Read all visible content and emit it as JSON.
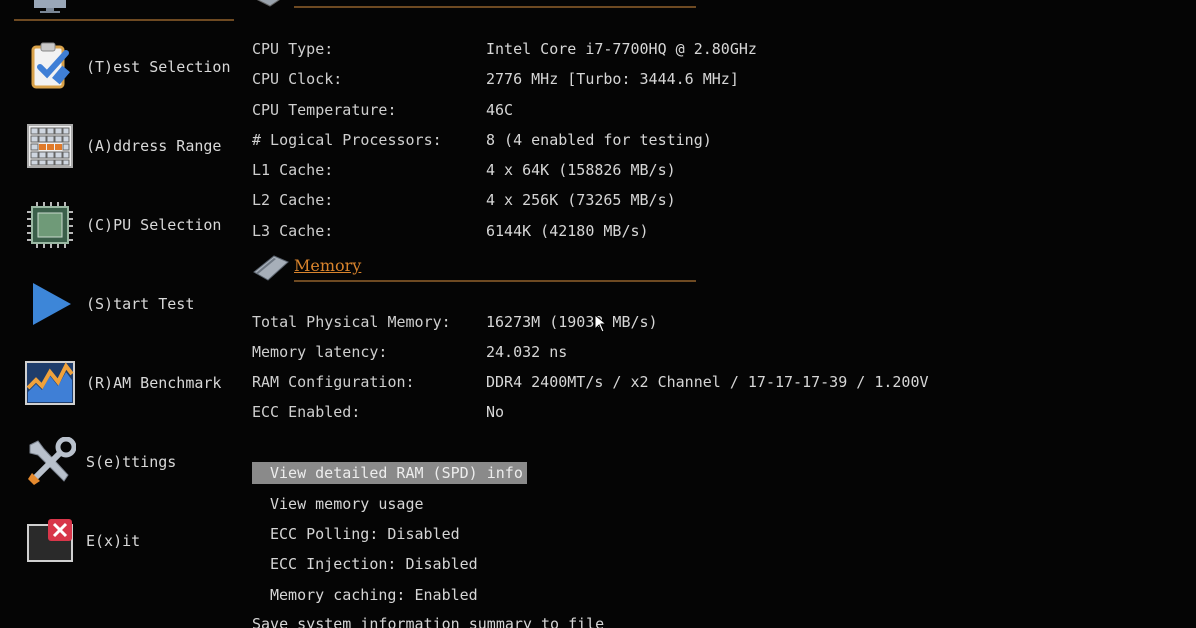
{
  "sidebar": {
    "items": [
      {
        "label": "(T)est Selection",
        "icon": "clipboard-check-icon"
      },
      {
        "label": "(A)ddress Range",
        "icon": "memory-grid-icon"
      },
      {
        "label": "(C)PU Selection",
        "icon": "cpu-chip-icon"
      },
      {
        "label": "(S)tart Test",
        "icon": "play-triangle-icon"
      },
      {
        "label": "(R)AM Benchmark",
        "icon": "benchmark-chart-icon"
      },
      {
        "label": "S(e)ttings",
        "icon": "tools-icon"
      },
      {
        "label": "E(x)it",
        "icon": "exit-window-icon"
      }
    ]
  },
  "cpu_info": {
    "rows": [
      {
        "key": "CPU Type:",
        "value": "Intel Core i7-7700HQ @ 2.80GHz"
      },
      {
        "key": "CPU Clock:",
        "value": "2776 MHz [Turbo: 3444.6 MHz]"
      },
      {
        "key": "CPU Temperature:",
        "value": "46C"
      },
      {
        "key": "# Logical Processors:",
        "value": "8 (4 enabled for testing)"
      },
      {
        "key": "L1 Cache:",
        "value": "4 x 64K (158826 MB/s)"
      },
      {
        "key": "L2 Cache:",
        "value": "4 x 256K (73265 MB/s)"
      },
      {
        "key": "L3 Cache:",
        "value": "6144K (42180 MB/s)"
      }
    ]
  },
  "memory": {
    "title": "Memory",
    "rows": [
      {
        "key": "Total Physical Memory:",
        "value": "16273M (19033 MB/s)"
      },
      {
        "key": "Memory latency:",
        "value": "24.032 ns"
      },
      {
        "key": "RAM Configuration:",
        "value": "DDR4 2400MT/s / x2 Channel / 17-17-17-39 / 1.200V"
      },
      {
        "key": "ECC Enabled:",
        "value": "No"
      }
    ]
  },
  "actions": [
    {
      "label": "View detailed RAM (SPD) info",
      "selected": true
    },
    {
      "label": "View memory usage",
      "selected": false
    },
    {
      "label": "ECC Polling: Disabled",
      "selected": false
    },
    {
      "label": "ECC Injection: Disabled",
      "selected": false
    },
    {
      "label": "Memory caching: Enabled",
      "selected": false
    },
    {
      "label": "Save system information summary to file",
      "selected": false
    }
  ],
  "colors": {
    "accent": "#d9842d",
    "divider": "#6e4a22",
    "selection": "#8a8a8a",
    "background": "#050505"
  }
}
